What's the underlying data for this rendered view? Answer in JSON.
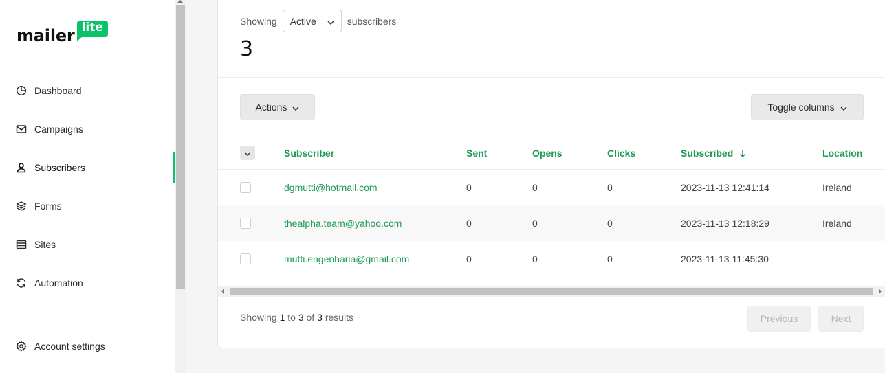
{
  "brand": {
    "name": "mailer",
    "badge": "lite",
    "accent": "#09c269"
  },
  "sidebar": {
    "items": [
      {
        "label": "Dashboard",
        "icon": "dashboard-icon"
      },
      {
        "label": "Campaigns",
        "icon": "mail-icon"
      },
      {
        "label": "Subscribers",
        "icon": "user-icon",
        "active": true
      },
      {
        "label": "Forms",
        "icon": "layers-icon"
      },
      {
        "label": "Sites",
        "icon": "browser-icon"
      },
      {
        "label": "Automation",
        "icon": "refresh-icon"
      }
    ],
    "account": {
      "label": "Account settings",
      "icon": "gear-icon"
    }
  },
  "filter": {
    "prefix": "Showing",
    "selected": "Active",
    "suffix": "subscribers"
  },
  "count": "3",
  "toolbar": {
    "actions_label": "Actions",
    "toggle_columns_label": "Toggle columns"
  },
  "table": {
    "columns": [
      "Subscriber",
      "Sent",
      "Opens",
      "Clicks",
      "Subscribed",
      "Location"
    ],
    "sort_column": "Subscribed",
    "sort_direction": "desc",
    "rows": [
      {
        "email": "dgmutti@hotmail.com",
        "sent": "0",
        "opens": "0",
        "clicks": "0",
        "subscribed": "2023-11-13 12:41:14",
        "location": "Ireland"
      },
      {
        "email": "thealpha.team@yahoo.com",
        "sent": "0",
        "opens": "0",
        "clicks": "0",
        "subscribed": "2023-11-13 12:18:29",
        "location": "Ireland"
      },
      {
        "email": "mutti.engenharia@gmail.com",
        "sent": "0",
        "opens": "0",
        "clicks": "0",
        "subscribed": "2023-11-13 11:45:30",
        "location": ""
      }
    ]
  },
  "pagination": {
    "showing": "Showing",
    "from": "1",
    "to_word": "to",
    "to": "3",
    "of_word": "of",
    "total": "3",
    "results": "results",
    "previous": "Previous",
    "next": "Next"
  }
}
